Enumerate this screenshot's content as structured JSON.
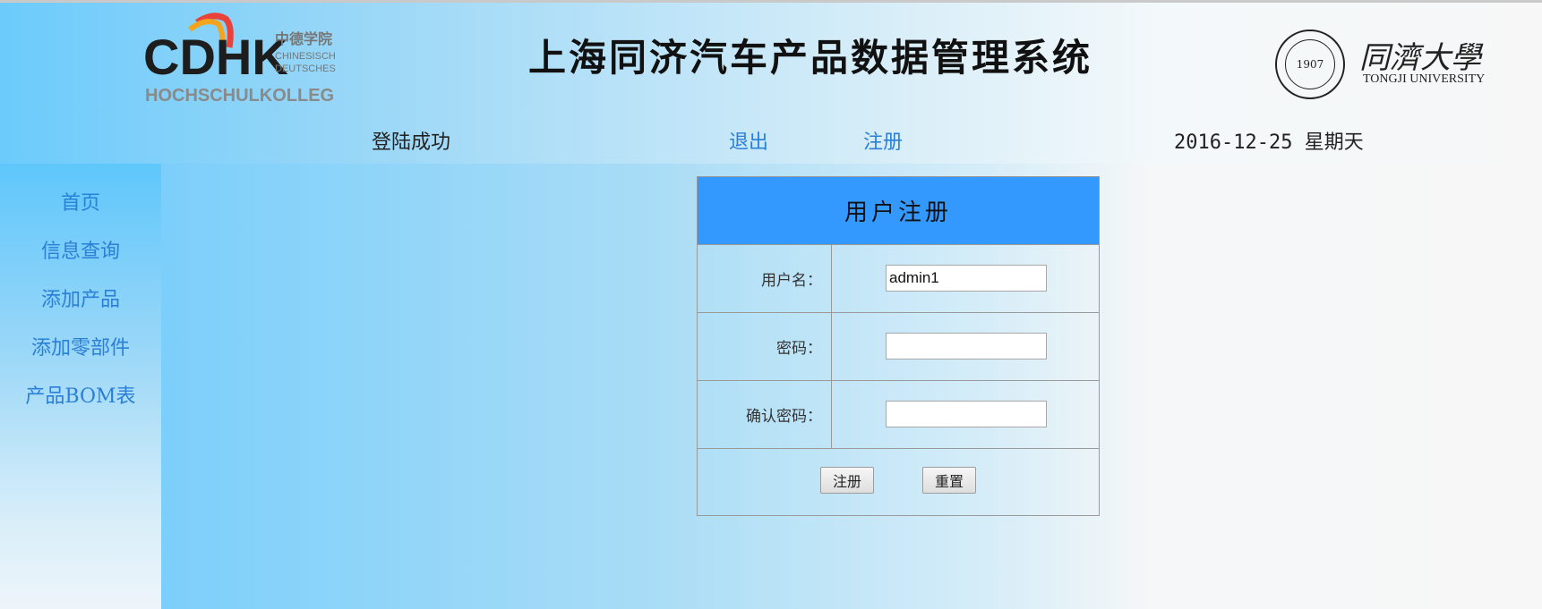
{
  "header": {
    "title": "上海同济汽车产品数据管理系统",
    "left_logo": {
      "brand": "CDHK",
      "cn": "中德学院",
      "line1": "CHINESISCH",
      "line2": "DEUTSCHES",
      "bottom": "HOCHSCHULKOLLEG"
    },
    "right_logo": {
      "seal_year": "1907",
      "name_cn": "同濟大學",
      "name_en": "TONGJI UNIVERSITY"
    }
  },
  "nav": {
    "status": "登陆成功",
    "logout": "退出",
    "register": "注册",
    "date": "2016-12-25 星期天"
  },
  "sidebar": {
    "items": [
      {
        "label": "首页"
      },
      {
        "label": "信息查询"
      },
      {
        "label": "添加产品"
      },
      {
        "label": "添加零部件"
      },
      {
        "label": "产品BOM表"
      }
    ]
  },
  "form": {
    "title": "用户注册",
    "username_label": "用户名：",
    "username_value": "admin1",
    "password_label": "密码：",
    "password_value": "",
    "confirm_label": "确认密码：",
    "confirm_value": "",
    "submit_label": "注册",
    "reset_label": "重置"
  },
  "colors": {
    "link": "#2a7fd6",
    "form_header": "#3399ff",
    "gradient_blue": "#6ccbfb"
  }
}
